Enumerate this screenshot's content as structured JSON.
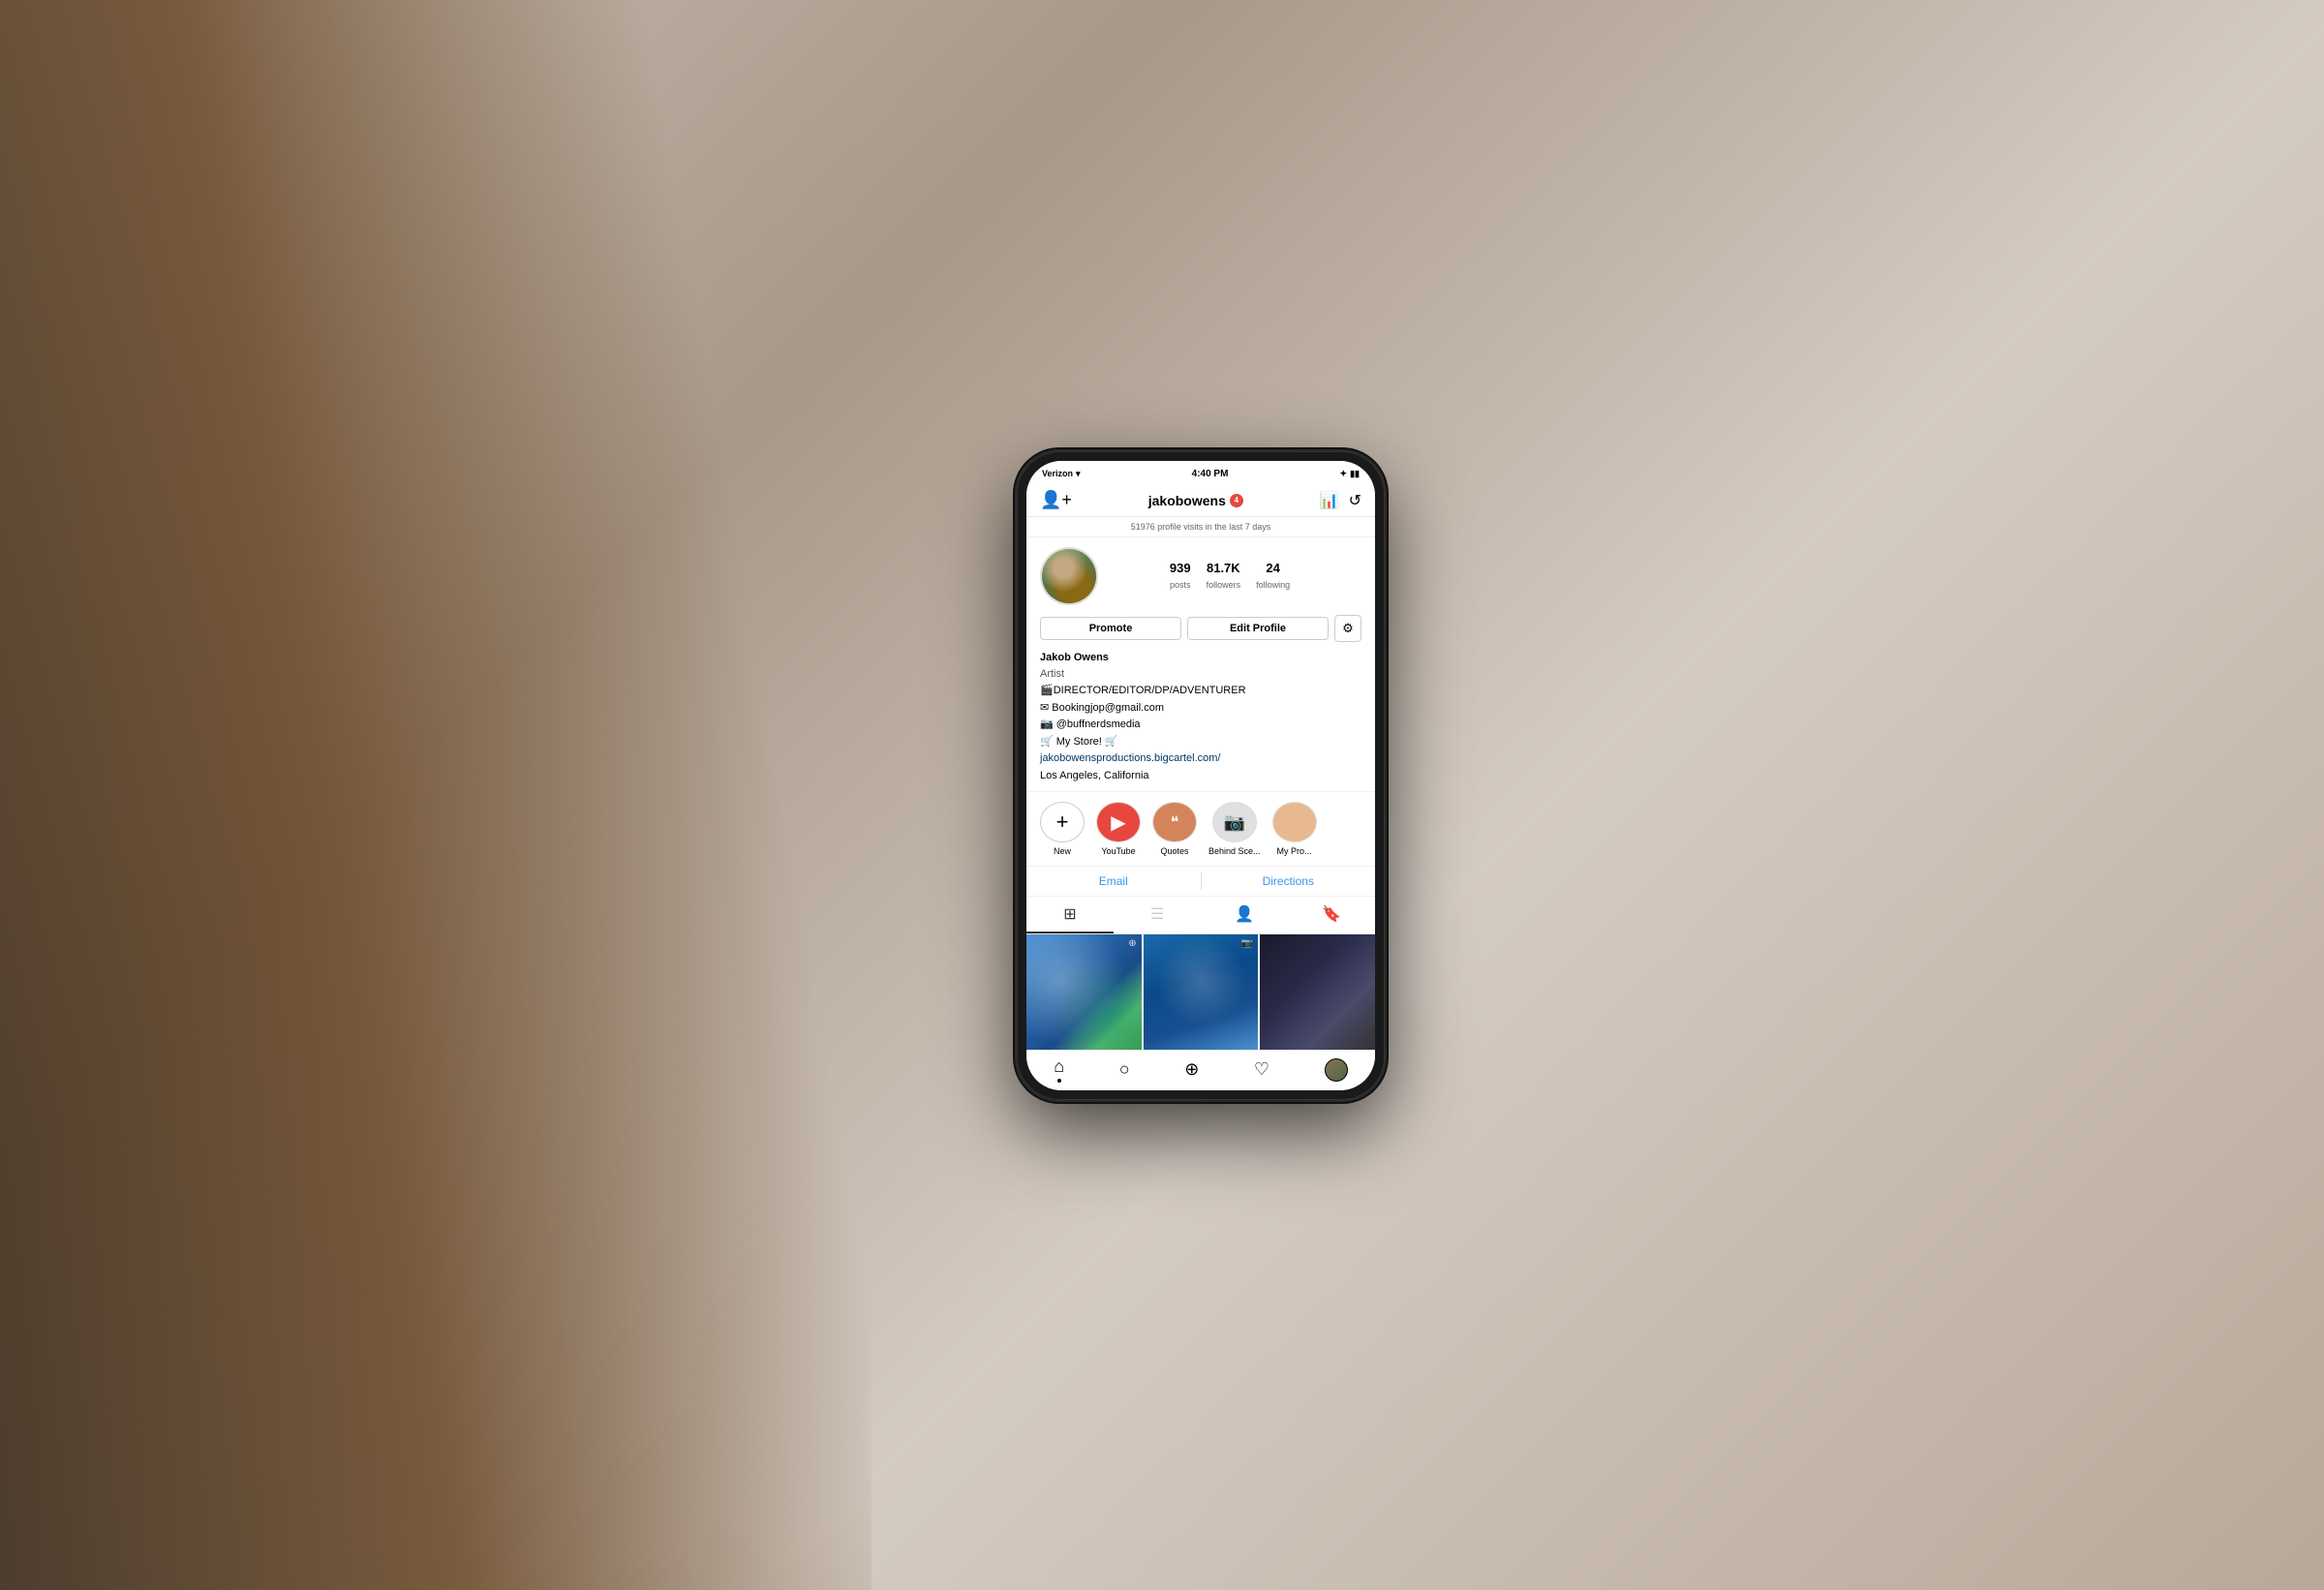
{
  "background": {
    "color": "#b8a898"
  },
  "phone": {
    "status_bar": {
      "carrier": "Verizon",
      "wifi_icon": "wifi",
      "time": "4:40 PM",
      "bluetooth_icon": "bluetooth",
      "battery_icon": "battery"
    },
    "nav": {
      "add_icon": "+",
      "username": "jakobowens",
      "notification_count": "4",
      "chart_icon": "chart",
      "refresh_icon": "refresh"
    },
    "insights": {
      "text": "51976 profile visits in the last 7 days"
    },
    "stats": {
      "posts": {
        "value": "939",
        "label": "posts"
      },
      "followers": {
        "value": "81.7K",
        "label": "followers"
      },
      "following": {
        "value": "24",
        "label": "following"
      }
    },
    "buttons": {
      "promote": "Promote",
      "edit_profile": "Edit Profile",
      "settings": "⚙"
    },
    "bio": {
      "name": "Jakob Owens",
      "category": "Artist",
      "line1": "🎬DIRECTOR/EDITOR/DP/ADVENTURER",
      "line2": "✉ Bookingjop@gmail.com",
      "line3": "📷 @buffnerdsmedia",
      "line4": "🛒 My Store! 🛒",
      "link": "jakobowensproductions.bigcartel.com/",
      "location": "Los Angeles, California"
    },
    "highlights": [
      {
        "id": "new",
        "label": "New",
        "icon": "+",
        "type": "new"
      },
      {
        "id": "youtube",
        "label": "YouTube",
        "icon": "▶",
        "type": "youtube"
      },
      {
        "id": "quotes",
        "label": "Quotes",
        "icon": "❝",
        "type": "quotes"
      },
      {
        "id": "behind",
        "label": "Behind Sce...",
        "icon": "📷",
        "type": "behind"
      },
      {
        "id": "mypr",
        "label": "My Pro...",
        "icon": "",
        "type": "mypr"
      }
    ],
    "contact": {
      "email": "Email",
      "directions": "Directions"
    },
    "grid_tabs": [
      {
        "id": "grid",
        "icon": "⊞",
        "active": true
      },
      {
        "id": "list",
        "icon": "☰",
        "active": false
      },
      {
        "id": "tag",
        "icon": "👤",
        "active": false
      },
      {
        "id": "bookmark",
        "icon": "🔖",
        "active": false
      }
    ],
    "bottom_nav": [
      {
        "id": "home",
        "icon": "⌂",
        "active": true
      },
      {
        "id": "search",
        "icon": "○"
      },
      {
        "id": "add",
        "icon": "⊕"
      },
      {
        "id": "heart",
        "icon": "♡"
      },
      {
        "id": "profile",
        "icon": "avatar"
      }
    ]
  }
}
